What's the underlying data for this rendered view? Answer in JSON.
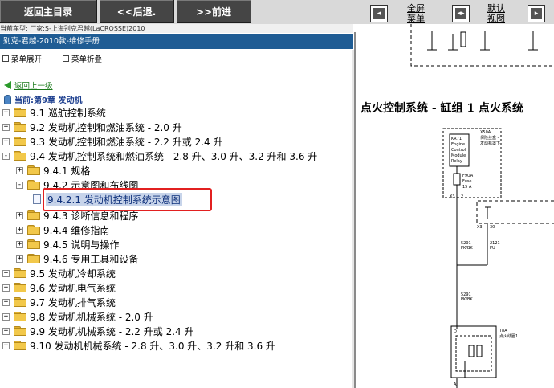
{
  "toolbar": {
    "home": "返回主目录",
    "back": "<<后退.",
    "forward": ">>前进",
    "fullscreen": [
      "全屏",
      "菜单"
    ],
    "default_view": [
      "默认",
      "视图"
    ]
  },
  "car_info": "当前车型: 厂家:S-上海别克君越(LaCROSSE)2010",
  "manual_title": "别克-君越-2010款-维修手册",
  "menu": {
    "expand": "菜单展开",
    "collapse": "菜单折叠"
  },
  "back_link": "返回上一级",
  "current": "当前:第9章 发动机",
  "tree": [
    {
      "label": "9.1 巡航控制系统",
      "level": 0,
      "state": "+",
      "icon": "folder"
    },
    {
      "label": "9.2 发动机控制和燃油系统 - 2.0 升",
      "level": 0,
      "state": "+",
      "icon": "folder"
    },
    {
      "label": "9.3 发动机控制和燃油系统 - 2.2 升或 2.4 升",
      "level": 0,
      "state": "+",
      "icon": "folder"
    },
    {
      "label": "9.4 发动机控制系统和燃油系统 - 2.8 升、3.0 升、3.2 升和 3.6 升",
      "level": 0,
      "state": "-",
      "icon": "folder"
    },
    {
      "label": "9.4.1 规格",
      "level": 1,
      "state": "+",
      "icon": "folder"
    },
    {
      "label": "9.4.2 示意图和布线图",
      "level": 1,
      "state": "-",
      "icon": "folder"
    },
    {
      "label": "9.4.2.1 发动机控制系统示意图",
      "level": 2,
      "state": "",
      "icon": "doc",
      "selected": true
    },
    {
      "label": "9.4.3 诊断信息和程序",
      "level": 1,
      "state": "+",
      "icon": "folder"
    },
    {
      "label": "9.4.4 维修指南",
      "level": 1,
      "state": "+",
      "icon": "folder"
    },
    {
      "label": "9.4.5 说明与操作",
      "level": 1,
      "state": "+",
      "icon": "folder"
    },
    {
      "label": "9.4.6 专用工具和设备",
      "level": 1,
      "state": "+",
      "icon": "folder"
    },
    {
      "label": "9.5 发动机冷却系统",
      "level": 0,
      "state": "+",
      "icon": "folder"
    },
    {
      "label": "9.6 发动机电气系统",
      "level": 0,
      "state": "+",
      "icon": "folder"
    },
    {
      "label": "9.7 发动机排气系统",
      "level": 0,
      "state": "+",
      "icon": "folder"
    },
    {
      "label": "9.8 发动机机械系统 - 2.0 升",
      "level": 0,
      "state": "+",
      "icon": "folder"
    },
    {
      "label": "9.9 发动机机械系统 - 2.2 升或 2.4 升",
      "level": 0,
      "state": "+",
      "icon": "folder"
    },
    {
      "label": "9.10 发动机机械系统 - 2.8 升、3.0 升、3.2 升和 3.6 升",
      "level": 0,
      "state": "+",
      "icon": "folder"
    }
  ],
  "diagram": {
    "title": "点火控制系统 - 缸组 1 点火系统",
    "relay_lines": [
      "KR71",
      "Engine",
      "Control",
      "Module",
      "Relay"
    ],
    "relay_note": [
      "X50A",
      "保险丝盒 -",
      "发动机罩下"
    ],
    "fuse_lines": [
      "F9UA",
      "Fuse",
      "15 A"
    ],
    "connectors": [
      "X3",
      "2",
      "X3",
      "30"
    ],
    "wire_a": [
      "5291",
      "PK/BK"
    ],
    "wire_b": [
      "2121",
      "PU"
    ],
    "wire_c": [
      "5291",
      "PK/BK"
    ],
    "coil_note": [
      "T8A",
      "点火线圈1"
    ],
    "pin_d": "D",
    "pin_a": "A"
  },
  "colors": {
    "toolbar_button": "#454545",
    "manual_bar": "#1f5c94",
    "highlight": "#e22020",
    "back_link": "#1a7a1a"
  },
  "icons": [
    "fullscreen-menu-icon",
    "default-view-icon",
    "panel-icon",
    "back-arrow-icon",
    "current-chapter-icon",
    "folder-icon",
    "document-icon"
  ]
}
